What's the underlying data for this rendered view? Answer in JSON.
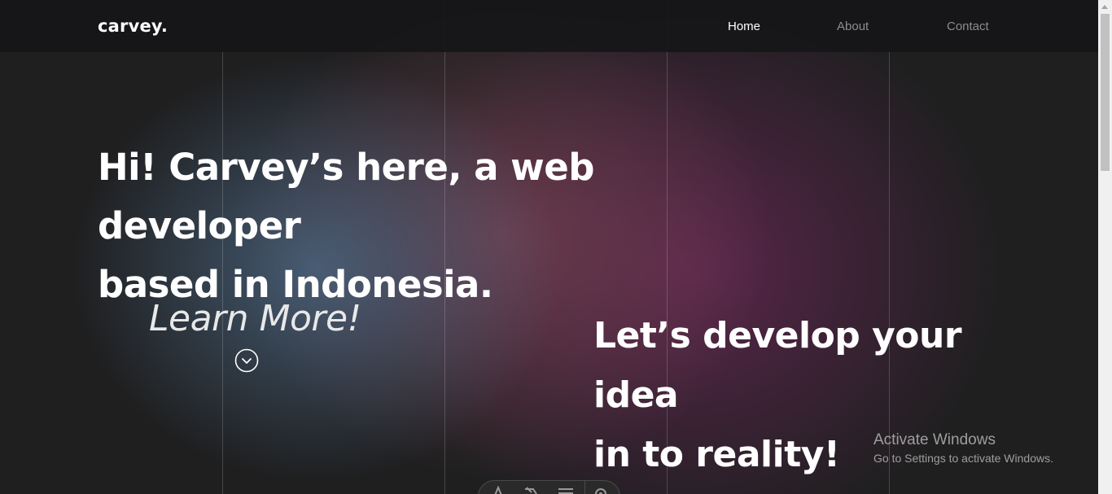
{
  "brand": {
    "logo": "carvey."
  },
  "nav": {
    "items": [
      {
        "label": "Home",
        "active": true
      },
      {
        "label": "About",
        "active": false
      },
      {
        "label": "Contact",
        "active": false
      }
    ]
  },
  "hero": {
    "headline_line1": "Hi! Carvey’s here, a web developer",
    "headline_line2": "based in Indonesia.",
    "learn_more": "Learn More!",
    "learn_more_icon": "chevron-down-circle-icon",
    "tagline_line1": "Let’s develop your idea",
    "tagline_line2": "in to reality!"
  },
  "watermark": {
    "title": "Activate Windows",
    "subtitle": "Go to Settings to activate Windows."
  },
  "toolbar": {
    "icons": [
      "text-tool-icon",
      "pen-tool-icon",
      "lines-tool-icon",
      "settings-icon"
    ]
  },
  "colors": {
    "background": "#1f1f20",
    "navbar": "#161618",
    "text": "#ffffff",
    "nav_inactive": "#8d8d8d"
  }
}
